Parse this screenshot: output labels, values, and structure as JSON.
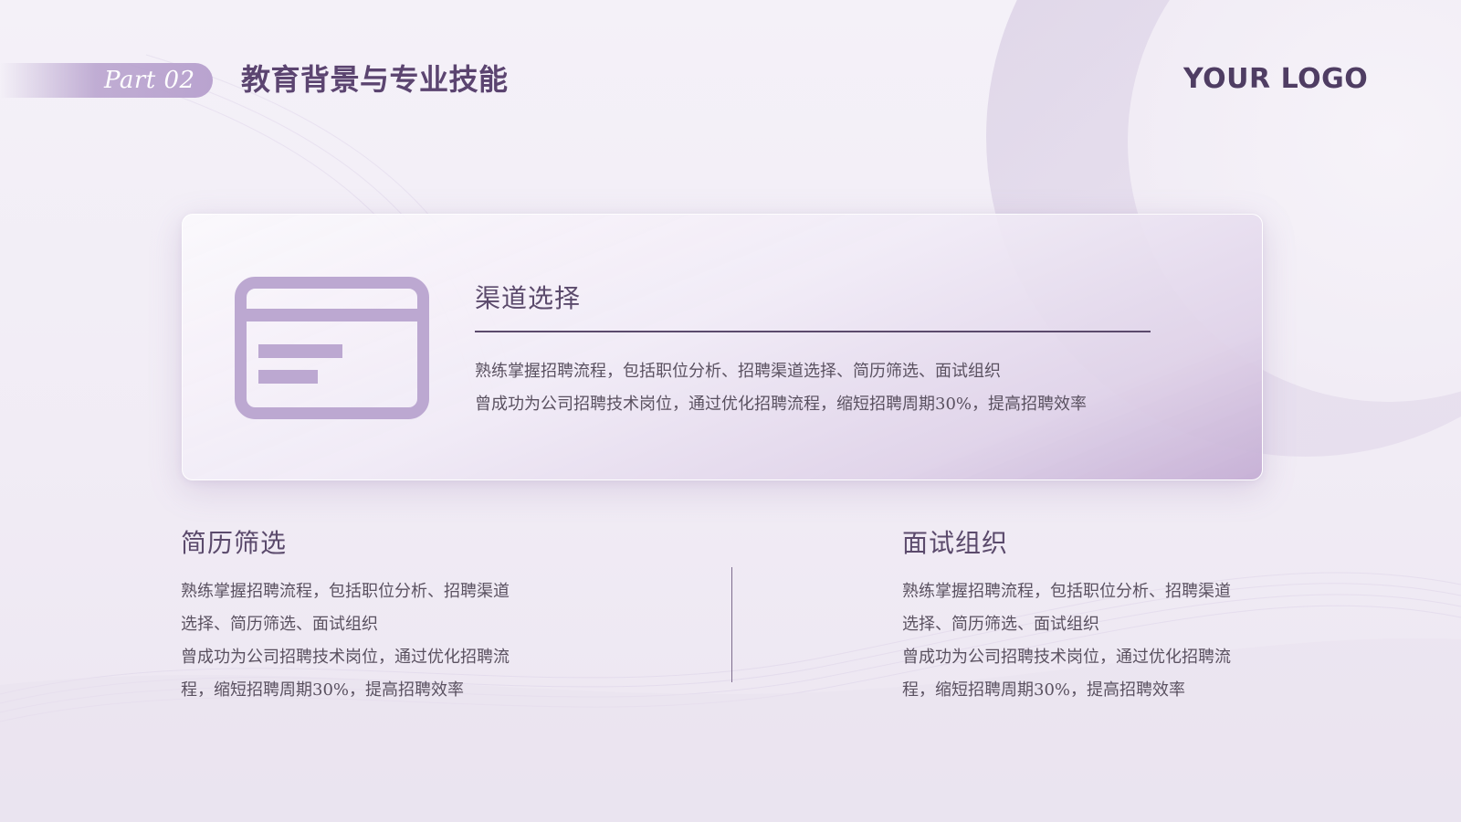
{
  "header": {
    "part_label": "Part 02",
    "title": "教育背景与专业技能",
    "logo": "YOUR LOGO"
  },
  "card": {
    "icon": "window-panel-icon",
    "title": "渠道选择",
    "lines": [
      "熟练掌握招聘流程，包括职位分析、招聘渠道选择、简历筛选、面试组织",
      "曾成功为公司招聘技术岗位，通过优化招聘流程，缩短招聘周期30%，提高招聘效率"
    ]
  },
  "sections": [
    {
      "title": "简历筛选",
      "lines": [
        "熟练掌握招聘流程，包括职位分析、招聘渠道",
        "选择、简历筛选、面试组织",
        "曾成功为公司招聘技术岗位，通过优化招聘流",
        "程，缩短招聘周期30%，提高招聘效率"
      ]
    },
    {
      "title": "面试组织",
      "lines": [
        "熟练掌握招聘流程，包括职位分析、招聘渠道",
        "选择、简历筛选、面试组织",
        "曾成功为公司招聘技术岗位，通过优化招聘流",
        "程，缩短招聘周期30%，提高招聘效率"
      ]
    }
  ],
  "colors": {
    "accent": "#bca8d1",
    "title": "#5b4470",
    "text": "#5a5160"
  }
}
